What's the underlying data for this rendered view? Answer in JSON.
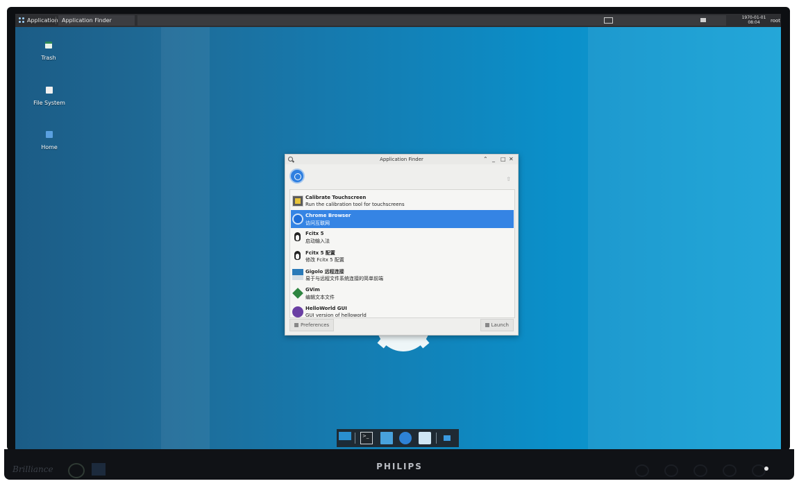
{
  "panel": {
    "applications_label": "Applications",
    "task_label": "Application Finder",
    "clock_date": "1970-01-01",
    "clock_time": "08:04",
    "user": "root"
  },
  "desktop": {
    "icons": [
      {
        "label": "Trash",
        "icon": "trash-icon"
      },
      {
        "label": "File System",
        "icon": "drive-icon"
      },
      {
        "label": "Home",
        "icon": "home-folder-icon"
      }
    ]
  },
  "dialog": {
    "title": "Application Finder",
    "search_value": "",
    "items": [
      {
        "name": "Calibrate Touchscreen",
        "desc": "Run the calibration tool for touchscreens",
        "icon": "calibrate-icon"
      },
      {
        "name": "Chrome Browser",
        "desc": "访问互联网",
        "icon": "chrome-icon"
      },
      {
        "name": "Fcitx 5",
        "desc": "启动输入法",
        "icon": "fcitx-penguin-icon"
      },
      {
        "name": "Fcitx 5 配置",
        "desc": "修改 Fcitx 5 配置",
        "icon": "fcitx-config-penguin-icon"
      },
      {
        "name": "Gigolo 远程连接",
        "desc": "易于与远程文件系统连接的简单前端",
        "icon": "gigolo-icon"
      },
      {
        "name": "GVim",
        "desc": "编辑文本文件",
        "icon": "gvim-icon"
      },
      {
        "name": "HelloWorld GUI",
        "desc": "GUI version of helloworld",
        "icon": "helloworld-icon"
      }
    ],
    "selected_index": 1,
    "preferences_label": "Preferences",
    "launch_label": "Launch"
  },
  "monitor": {
    "brand_left": "Brilliance",
    "brand_center": "PHILIPS"
  },
  "colors": {
    "selection": "#3584e4",
    "panel": "#2d2e31",
    "desktop_accent": "#0b8fc9"
  }
}
